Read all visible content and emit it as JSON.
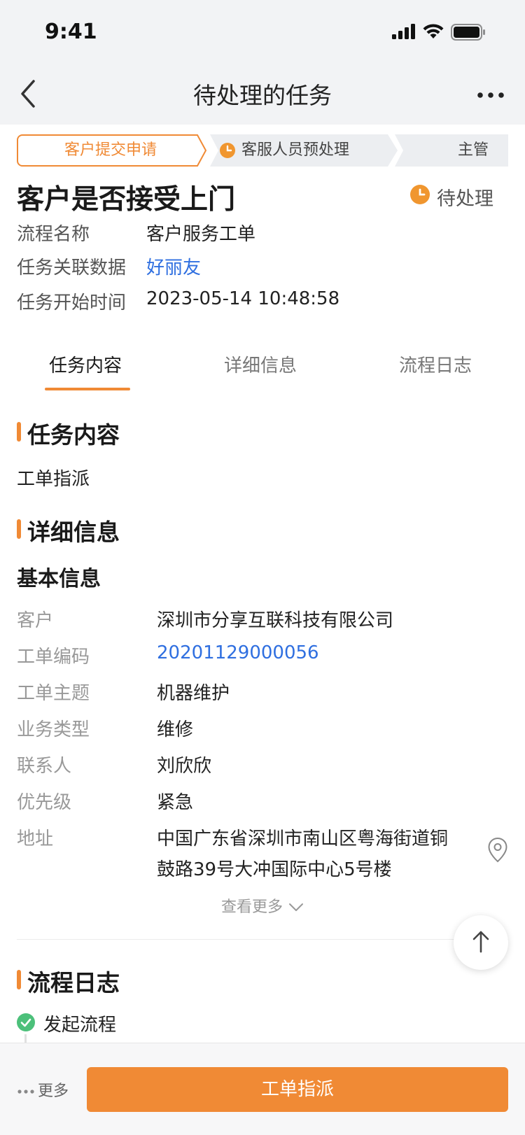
{
  "status_bar": {
    "time": "9:41"
  },
  "nav": {
    "title": "待处理的任务"
  },
  "steps": [
    {
      "label": "客户提交申请",
      "state": "done"
    },
    {
      "label": "客服人员预处理",
      "state": "current"
    },
    {
      "label": "主管",
      "state": "pending"
    }
  ],
  "task": {
    "title": "客户是否接受上门",
    "status": "待处理",
    "rows": [
      {
        "label": "流程名称",
        "value": "客户服务工单"
      },
      {
        "label": "任务关联数据",
        "value": "好丽友"
      },
      {
        "label": "任务开始时间",
        "value": "2023-05-14 10:48:58"
      }
    ]
  },
  "tabs": [
    {
      "label": "任务内容",
      "active": true
    },
    {
      "label": "详细信息",
      "active": false
    },
    {
      "label": "流程日志",
      "active": false
    }
  ],
  "task_content": {
    "heading": "任务内容",
    "text": "工单指派"
  },
  "details": {
    "heading": "详细信息",
    "subheading": "基本信息",
    "rows": [
      {
        "label": "客户",
        "value": "深圳市分享互联科技有限公司"
      },
      {
        "label": "工单编码",
        "value": "20201129000056"
      },
      {
        "label": "工单主题",
        "value": "机器维护"
      },
      {
        "label": "业务类型",
        "value": "维修"
      },
      {
        "label": "联系人",
        "value": "刘欣欣"
      },
      {
        "label": "优先级",
        "value": "紧急"
      }
    ],
    "address": {
      "label": "地址",
      "line1": "中国广东省深圳市南山区粤海街道铜",
      "line2": "鼓路39号大冲国际中心5号楼"
    },
    "see_more": "查看更多"
  },
  "process_log": {
    "heading": "流程日志",
    "items": [
      {
        "label": "发起流程"
      }
    ]
  },
  "bottom": {
    "more_label": "更多",
    "primary_label": "工单指派"
  },
  "colors": {
    "accent": "#f08a35",
    "link": "#2f6fe0",
    "success": "#4cc07a"
  }
}
